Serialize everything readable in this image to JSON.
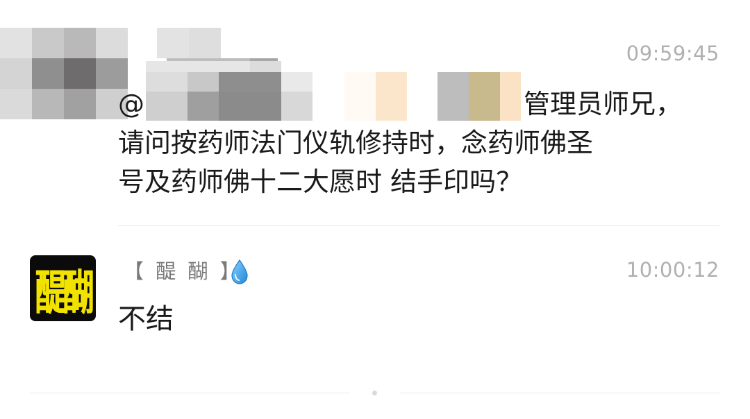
{
  "messages": [
    {
      "sender": "",
      "time": "09:59:45",
      "mention_prefix": "@",
      "text_lines": [
        "管理员师兄，",
        "请问按药师法门仪轨修持时，念药师佛圣",
        "号及药师佛十二大愿时 结手印吗？"
      ]
    },
    {
      "sender": "【 醍 醐 】",
      "avatar_text": "醍醐",
      "avatar_colors": {
        "background": "#0b0b0b",
        "text": "#f2e200"
      },
      "time": "10:00:12",
      "text": "不结",
      "badge_icon": "water-drop-icon"
    }
  ],
  "colors": {
    "time": "#b0b0b0",
    "name": "#7a7a7a",
    "message_text": "#1a1a1a",
    "drop": "#3aa0e8",
    "divider": "#e6e6e6"
  }
}
